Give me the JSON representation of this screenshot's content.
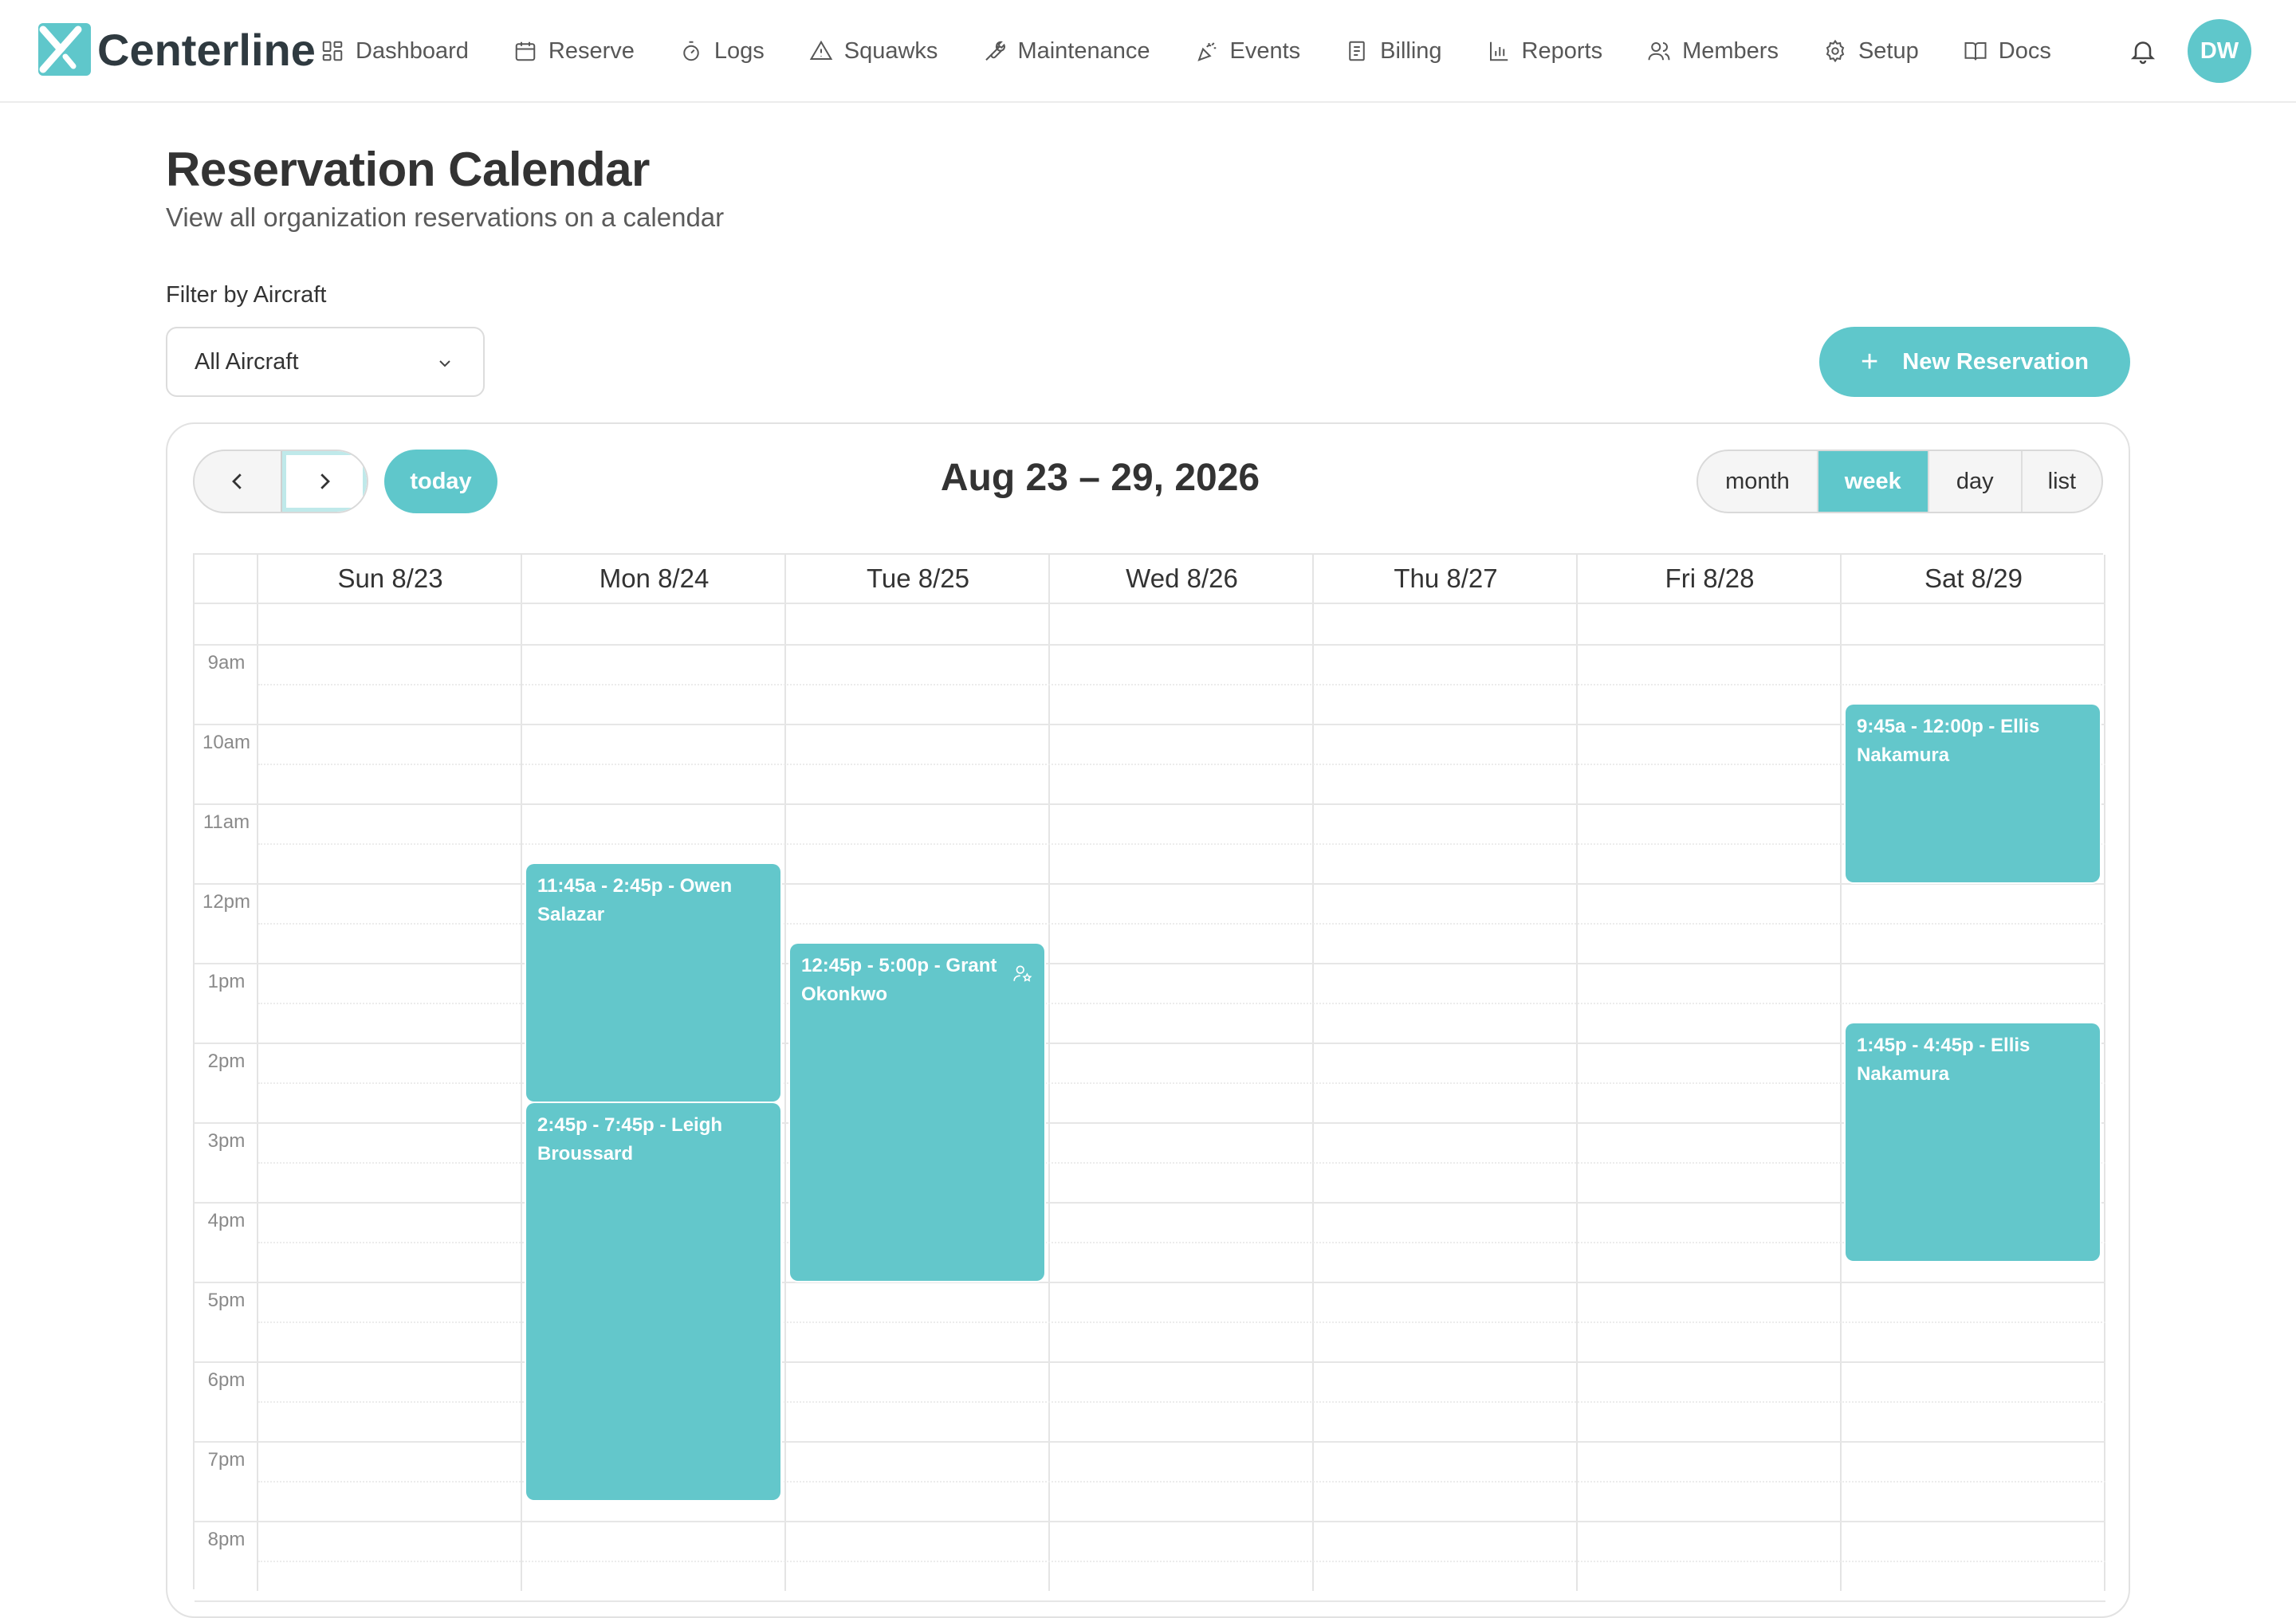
{
  "brand": {
    "name": "Centerline"
  },
  "nav": {
    "items": [
      {
        "label": "Dashboard",
        "icon": "dashboard-icon"
      },
      {
        "label": "Reserve",
        "icon": "calendar-icon"
      },
      {
        "label": "Logs",
        "icon": "stopwatch-icon"
      },
      {
        "label": "Squawks",
        "icon": "warning-triangle-icon"
      },
      {
        "label": "Maintenance",
        "icon": "wrench-icon"
      },
      {
        "label": "Events",
        "icon": "party-popper-icon"
      },
      {
        "label": "Billing",
        "icon": "receipt-icon"
      },
      {
        "label": "Reports",
        "icon": "bar-chart-icon"
      },
      {
        "label": "Members",
        "icon": "users-icon"
      },
      {
        "label": "Setup",
        "icon": "gear-icon"
      },
      {
        "label": "Docs",
        "icon": "book-icon"
      }
    ],
    "avatar_initials": "DW"
  },
  "page": {
    "title": "Reservation Calendar",
    "subtitle": "View all organization reservations on a calendar",
    "filter_label": "Filter by Aircraft",
    "filter_value": "All Aircraft",
    "new_button": "New Reservation"
  },
  "calendar": {
    "today_label": "today",
    "range_title": "Aug 23 – 29, 2026",
    "views": [
      "month",
      "week",
      "day",
      "list"
    ],
    "active_view": "week",
    "days": [
      "Sun 8/23",
      "Mon 8/24",
      "Tue 8/25",
      "Wed 8/26",
      "Thu 8/27",
      "Fri 8/28",
      "Sat 8/29"
    ],
    "hours": [
      "9am",
      "10am",
      "11am",
      "12pm",
      "1pm",
      "2pm",
      "3pm",
      "4pm",
      "5pm",
      "6pm",
      "7pm",
      "8pm"
    ],
    "events": [
      {
        "day": 1,
        "start": 11.75,
        "end": 14.75,
        "label": "11:45a - 2:45p - Owen Salazar"
      },
      {
        "day": 1,
        "start": 14.75,
        "end": 19.75,
        "label": "2:45p - 7:45p - Leigh Broussard"
      },
      {
        "day": 2,
        "start": 12.75,
        "end": 17.0,
        "label": "12:45p - 5:00p - Grant Okonkwo",
        "icon": "user-star-icon"
      },
      {
        "day": 6,
        "start": 9.75,
        "end": 12.0,
        "label": "9:45a - 12:00p - Ellis Nakamura"
      },
      {
        "day": 6,
        "start": 13.75,
        "end": 16.75,
        "label": "1:45p - 4:45p - Ellis Nakamura"
      }
    ]
  }
}
